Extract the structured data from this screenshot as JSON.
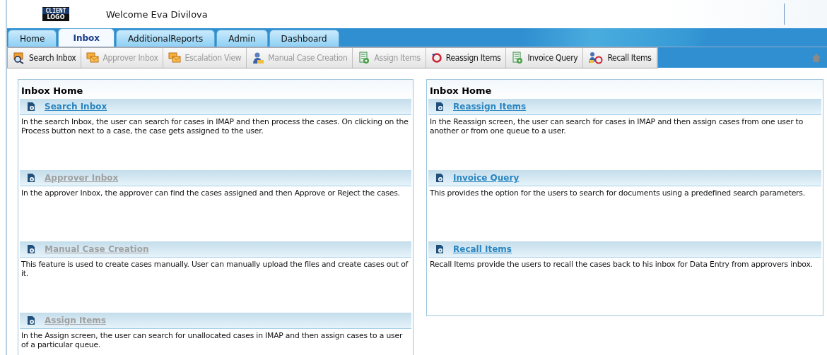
{
  "header": {
    "logo": {
      "line_1": "CLIENT",
      "line_2": "LOGO"
    },
    "welcome": "Welcome Eva Divilova"
  },
  "tabs": [
    {
      "label": "Home",
      "selected": false
    },
    {
      "label": "Inbox",
      "selected": true
    },
    {
      "label": "AdditionalReports",
      "selected": false
    },
    {
      "label": "Admin",
      "selected": false
    },
    {
      "label": "Dashboard",
      "selected": false
    }
  ],
  "toolbar": [
    {
      "label": "Search Inbox",
      "disabled": false,
      "kind": "search"
    },
    {
      "label": "Approver Inbox",
      "disabled": true,
      "kind": "mail"
    },
    {
      "label": "Escalation View",
      "disabled": true,
      "kind": "mail"
    },
    {
      "label": "Manual Case Creation",
      "disabled": true,
      "kind": "user"
    },
    {
      "label": "Assign Items",
      "disabled": true,
      "kind": "doc"
    },
    {
      "label": "Reassign Items",
      "disabled": false,
      "kind": "cycle"
    },
    {
      "label": "Invoice Query",
      "disabled": false,
      "kind": "doc"
    },
    {
      "label": "Recall Items",
      "disabled": false,
      "kind": "usercycle"
    }
  ],
  "panels": [
    {
      "title": "Inbox Home",
      "sections": [
        {
          "link": "Search Inbox",
          "disabled": false,
          "text": "In the search Inbox, the user can search for cases in IMAP and then process the cases. On clicking on the Process button next to a case, the case gets assigned to the user."
        },
        {
          "link": "Approver Inbox",
          "disabled": true,
          "text": "In the approver Inbox, the approver can find the cases assigned and then Approve or Reject the cases."
        },
        {
          "link": "Manual Case Creation",
          "disabled": true,
          "text": "This feature is used to create cases manually. User can manually upload the files and create cases out of it."
        },
        {
          "link": "Assign Items",
          "disabled": true,
          "text": "In the Assign screen, the user can search for unallocated cases in IMAP and then assign cases to a user of a particular queue."
        }
      ]
    },
    {
      "title": "Inbox Home",
      "sections": [
        {
          "link": "Reassign Items",
          "disabled": false,
          "text": "In the Reassign screen, the user can search for cases in IMAP and then assign cases from one user to another or from one queue to a user."
        },
        {
          "link": "Invoice Query",
          "disabled": false,
          "text": "This provides the option for the users to search for documents using a predefined search parameters."
        },
        {
          "link": "Recall Items",
          "disabled": false,
          "text": "Recall Items provide the users to recall the cases back to his inbox for Data Entry from approvers inbox."
        }
      ]
    }
  ]
}
